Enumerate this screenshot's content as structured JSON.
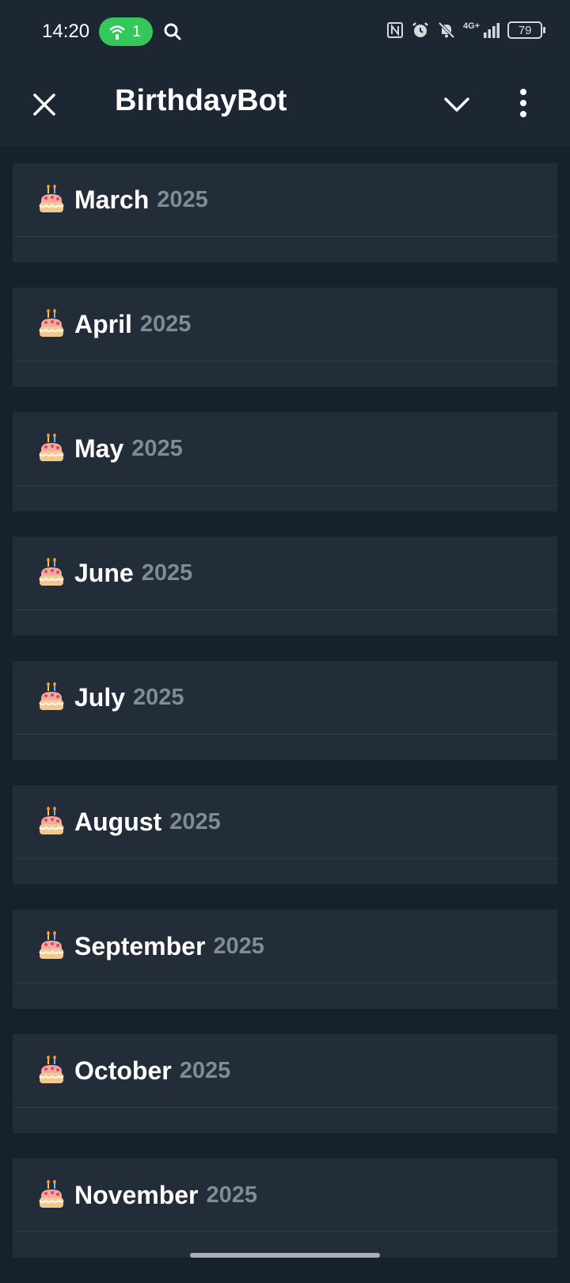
{
  "status_bar": {
    "time": "14:20",
    "hotspot_count": "1",
    "battery": "79",
    "network": "4G+"
  },
  "header": {
    "title": "BirthdayBot"
  },
  "months": [
    {
      "name": "March",
      "year": "2025"
    },
    {
      "name": "April",
      "year": "2025"
    },
    {
      "name": "May",
      "year": "2025"
    },
    {
      "name": "June",
      "year": "2025"
    },
    {
      "name": "July",
      "year": "2025"
    },
    {
      "name": "August",
      "year": "2025"
    },
    {
      "name": "September",
      "year": "2025"
    },
    {
      "name": "October",
      "year": "2025"
    },
    {
      "name": "November",
      "year": "2025"
    }
  ],
  "colors": {
    "background": "#17212b",
    "card": "#222d39",
    "header": "#1c2733",
    "year_text": "#7f8b97",
    "hotspot": "#34c759"
  },
  "icons": {
    "month_icon": "birthday-cake-icon"
  }
}
